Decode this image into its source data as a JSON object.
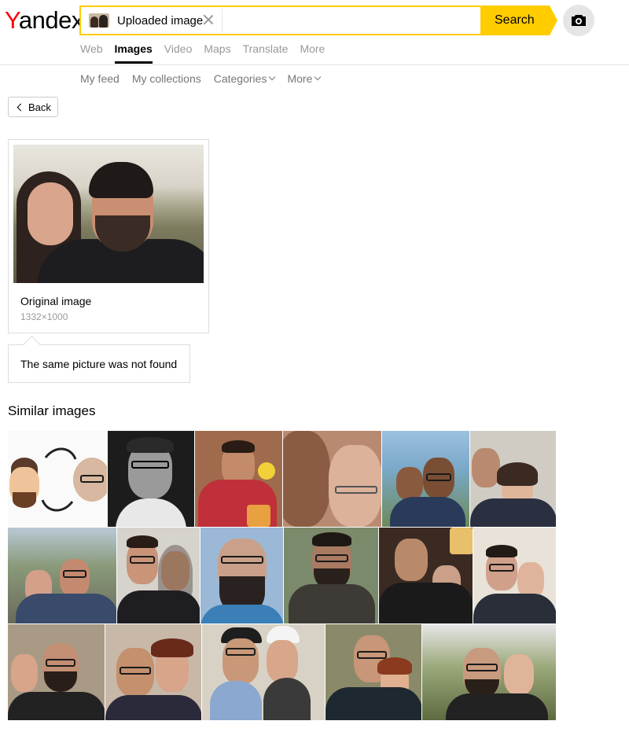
{
  "logo": {
    "first": "Y",
    "rest": "andex"
  },
  "search": {
    "chip_label": "Uploaded image",
    "query_placeholder": "",
    "button_label": "Search"
  },
  "tabs": [
    {
      "label": "Web"
    },
    {
      "label": "Images",
      "active": true
    },
    {
      "label": "Video"
    },
    {
      "label": "Maps"
    },
    {
      "label": "Translate"
    },
    {
      "label": "More"
    }
  ],
  "subnav": {
    "my_feed": "My feed",
    "my_collections": "My collections",
    "categories": "Categories",
    "more": "More"
  },
  "back": {
    "label": "Back"
  },
  "original": {
    "title": "Original image",
    "size": "1332×1000"
  },
  "not_found": {
    "message": "The same picture was not found"
  },
  "similar": {
    "title": "Similar images"
  },
  "colors": {
    "accent": "#ffcc00",
    "brand_red": "#ff0000",
    "muted_text": "#999999"
  },
  "icons": {
    "camera": "camera-icon",
    "clear": "close-icon",
    "back": "chevron-left-icon"
  }
}
